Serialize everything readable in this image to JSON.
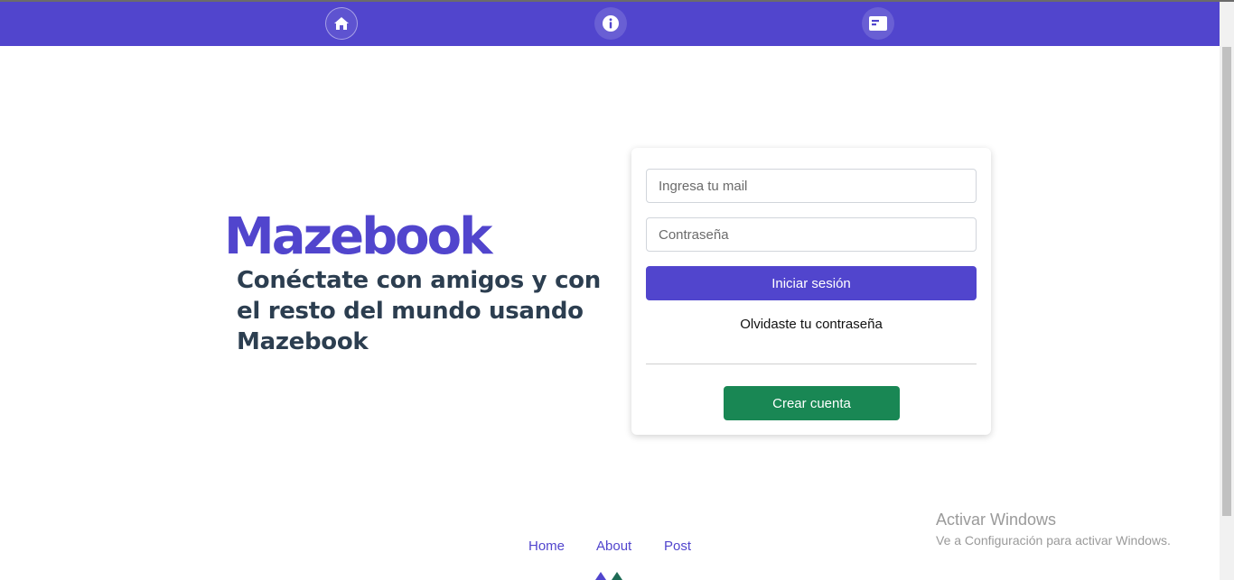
{
  "navbar": {
    "items": [
      {
        "name": "home",
        "icon": "home-icon"
      },
      {
        "name": "about",
        "icon": "info-icon"
      },
      {
        "name": "post",
        "icon": "post-icon"
      }
    ],
    "color": "#5145cd"
  },
  "hero": {
    "brand": "Mazebook",
    "tagline": "Conéctate con amigos y con el resto del mundo usando Mazebook"
  },
  "login": {
    "email_placeholder": "Ingresa tu mail",
    "password_placeholder": "Contraseña",
    "login_label": "Iniciar sesión",
    "forgot_label": "Olvidaste tu contraseña",
    "create_label": "Crear cuenta"
  },
  "footer": {
    "links": [
      "Home",
      "About",
      "Post"
    ]
  },
  "watermark": {
    "title": "Activar Windows",
    "subtitle": "Ve a Configuración para activar Windows."
  },
  "colors": {
    "accent": "#5145cd",
    "success": "#198754",
    "heading": "#2c3e50"
  }
}
